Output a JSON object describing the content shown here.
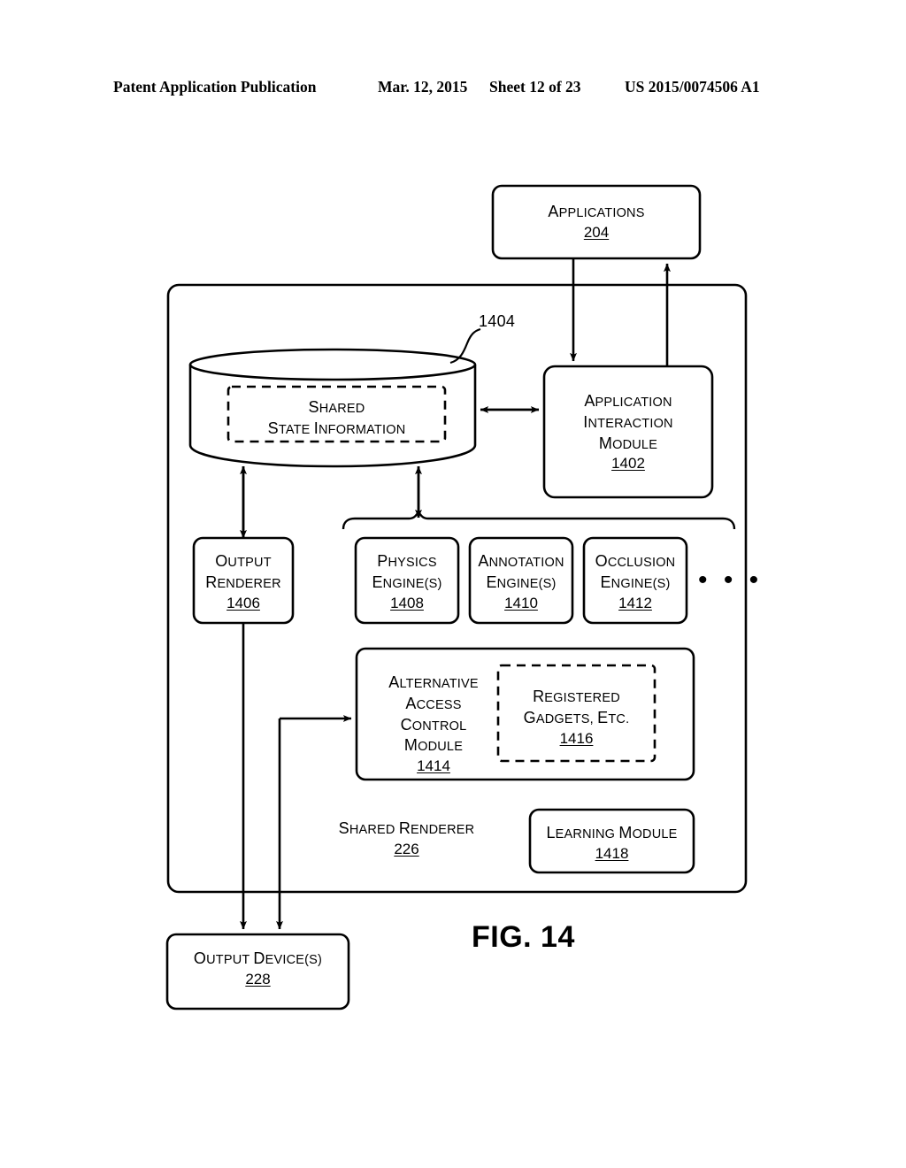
{
  "header": {
    "publication": "Patent Application Publication",
    "date": "Mar. 12, 2015",
    "sheet": "Sheet 12 of 23",
    "patent_number": "US 2015/0074506 A1"
  },
  "figure": {
    "label": "FIG. 14",
    "ellipsis": "• • •"
  },
  "nodes": {
    "applications": {
      "line1": "Applications",
      "ref": "204"
    },
    "shared_state": {
      "line1": "Shared",
      "line2": "State Information"
    },
    "datastore_ref": "1404",
    "application_interaction": {
      "line1": "Application",
      "line2": "Interaction",
      "line3": "Module",
      "ref": "1402"
    },
    "output_renderer": {
      "line1": "Output",
      "line2": "Renderer",
      "ref": "1406"
    },
    "physics_engine": {
      "line1": "Physics",
      "line2": "Engine(s)",
      "ref": "1408"
    },
    "annotation_engine": {
      "line1": "Annotation",
      "line2": "Engine(s)",
      "ref": "1410"
    },
    "occlusion_engine": {
      "line1": "Occlusion",
      "line2": "Engine(s)",
      "ref": "1412"
    },
    "alternative_access_control": {
      "line1": "Alternative",
      "line2": "Access",
      "line3": "Control",
      "line4": "Module",
      "ref": "1414"
    },
    "registered_gadgets": {
      "line1": "Registered",
      "line2": "Gadgets, etc.",
      "ref": "1416"
    },
    "shared_renderer": {
      "line1": "Shared Renderer",
      "ref": "226"
    },
    "learning_module": {
      "line1": "Learning Module",
      "ref": "1418"
    },
    "output_devices": {
      "line1": "Output Device(s)",
      "ref": "228"
    }
  },
  "colors": {
    "stroke": "#000000",
    "background": "#ffffff"
  }
}
